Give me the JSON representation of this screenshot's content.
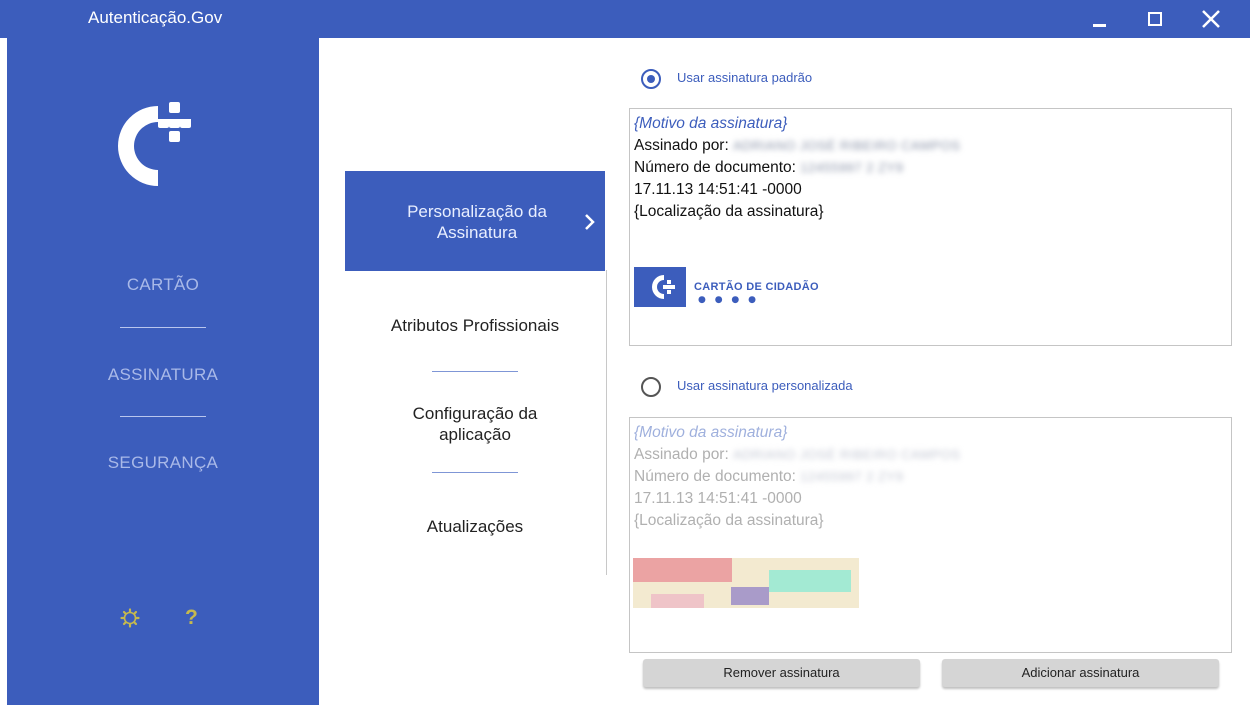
{
  "window": {
    "title": "Autenticação.Gov"
  },
  "sidebar": {
    "items": [
      {
        "label": "CARTÃO"
      },
      {
        "label": "ASSINATURA"
      },
      {
        "label": "SEGURANÇA"
      }
    ],
    "help_label": "?"
  },
  "submenu": {
    "items": [
      {
        "label": "Personalização da Assinatura",
        "active": true
      },
      {
        "label": "Atributos Profissionais"
      },
      {
        "label": "Configuração da aplicação"
      },
      {
        "label": "Atualizações"
      }
    ]
  },
  "signature": {
    "default_option": {
      "label": "Usar assinatura padrão",
      "selected": true
    },
    "custom_option": {
      "label": "Usar assinatura personalizada",
      "selected": false
    },
    "motivo": "{Motivo da assinatura}",
    "signed_by_label": "Assinado por:",
    "signed_by_value": "ADRIANO JOSÉ RIBEIRO CAMPOS",
    "doc_number_label": "Número de documento:",
    "doc_number_value": "12455997 2 ZY9",
    "datetime": "17.11.13 14:51:41 -0000",
    "location": "{Localização da assinatura}",
    "card_brand": "CARTÃO DE CIDADÃO",
    "card_dots": "● ● ● ●"
  },
  "buttons": {
    "remove": "Remover assinatura",
    "add": "Adicionar assinatura"
  },
  "colors": {
    "accent": "#3c5dbc",
    "sidebar_text": "#a9b9e8",
    "help_icon": "#c6b94e"
  }
}
